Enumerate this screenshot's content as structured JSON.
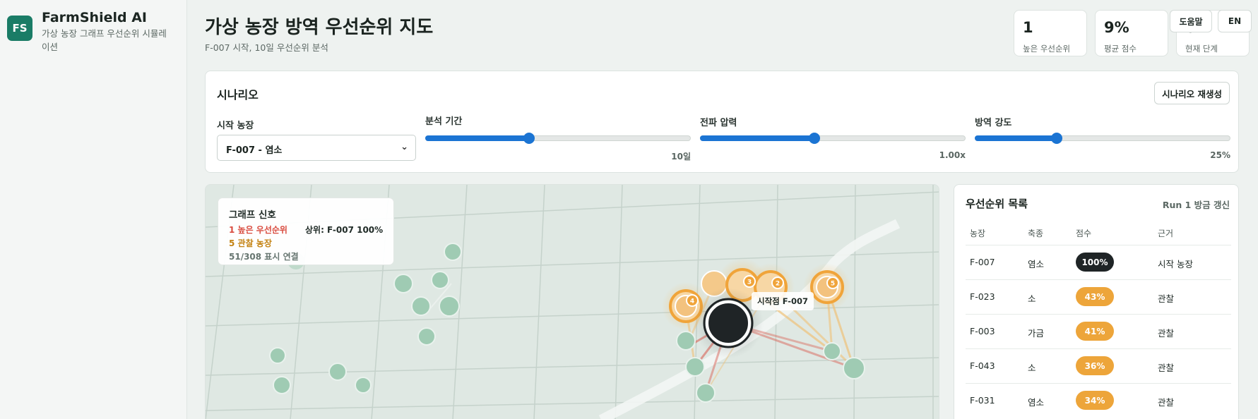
{
  "brand": {
    "logo": "FS",
    "name": "FarmShield AI",
    "subtitle": "가상 농장 그래프 우선순위 시뮬레이션"
  },
  "header": {
    "title": "가상 농장 방역 우선순위 지도",
    "subtitle": "F-007 시작, 10일 우선순위 분석"
  },
  "stats": [
    {
      "value": "1",
      "label": "높은 우선순위"
    },
    {
      "value": "9%",
      "label": "평균 점수"
    },
    {
      "value": "0",
      "label": "현재 단계"
    }
  ],
  "buttons": {
    "help": "도움말",
    "lang": "EN",
    "regen": "시나리오 재생성"
  },
  "scenario": {
    "title": "시나리오",
    "start_farm": {
      "label": "시작 농장",
      "value": "F-007 - 염소"
    },
    "period": {
      "label": "분석 기간",
      "value": "10일",
      "fraction": 0.39
    },
    "pressure": {
      "label": "전파 압력",
      "value": "1.00x",
      "fraction": 0.43
    },
    "intensity": {
      "label": "방역 강도",
      "value": "25%",
      "fraction": 0.32
    }
  },
  "map": {
    "legend": {
      "title": "그래프 신호",
      "high": "1 높은 우선순위",
      "top": "상위: F-007 100%",
      "watch": "5 관찰 농장",
      "links": "51/308 표시 연결"
    },
    "start_tag": "시작점 F-007",
    "marker_labels": [
      "2",
      "3",
      "4",
      "5"
    ],
    "colors": {
      "start": "#1f2426",
      "watch": "#f0a43a",
      "normal": "#8fc3a8",
      "edge_high": "#d9584b",
      "edge_watch": "#f0c27a"
    }
  },
  "priority": {
    "title": "우선순위 목록",
    "run": "Run 1 방금 갱신",
    "columns": [
      "농장",
      "축종",
      "점수",
      "근거"
    ],
    "rows": [
      {
        "farm": "F-007",
        "species": "염소",
        "score": "100%",
        "reason": "시작 농장",
        "color": "#1f2426"
      },
      {
        "farm": "F-023",
        "species": "소",
        "score": "43%",
        "reason": "관찰",
        "color": "#eda53a"
      },
      {
        "farm": "F-003",
        "species": "가금",
        "score": "41%",
        "reason": "관찰",
        "color": "#eda53a"
      },
      {
        "farm": "F-043",
        "species": "소",
        "score": "36%",
        "reason": "관찰",
        "color": "#eda53a"
      },
      {
        "farm": "F-031",
        "species": "염소",
        "score": "34%",
        "reason": "관찰",
        "color": "#eda53a"
      }
    ]
  }
}
